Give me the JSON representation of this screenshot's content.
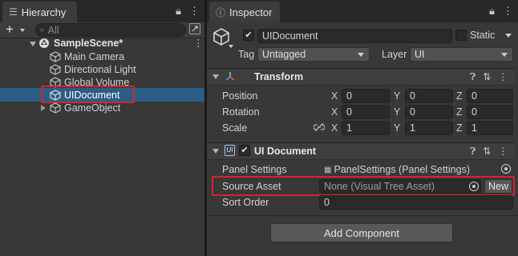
{
  "hierarchy": {
    "tab_label": "Hierarchy",
    "search_placeholder": "All",
    "add_label": "+",
    "scene": {
      "name": "SampleScene*"
    },
    "items": [
      {
        "label": "Main Camera"
      },
      {
        "label": "Directional Light"
      },
      {
        "label": "Global Volume"
      },
      {
        "label": "UIDocument"
      },
      {
        "label": "GameObject"
      }
    ]
  },
  "inspector": {
    "tab_label": "Inspector",
    "object_name": "UIDocument",
    "static_label": "Static",
    "tag_label": "Tag",
    "tag_value": "Untagged",
    "layer_label": "Layer",
    "layer_value": "UI",
    "transform": {
      "title": "Transform",
      "rows": [
        {
          "label": "Position",
          "x": "0",
          "y": "0",
          "z": "0"
        },
        {
          "label": "Rotation",
          "x": "0",
          "y": "0",
          "z": "0"
        },
        {
          "label": "Scale",
          "x": "1",
          "y": "1",
          "z": "1"
        }
      ],
      "axis_x": "X",
      "axis_y": "Y",
      "axis_z": "Z"
    },
    "ui_document": {
      "title": "UI Document",
      "icon_text": "UI",
      "panel_settings_label": "Panel Settings",
      "panel_settings_value": "PanelSettings (Panel Settings)",
      "source_asset_label": "Source Asset",
      "source_asset_value": "None (Visual Tree Asset)",
      "new_button": "New",
      "sort_order_label": "Sort Order",
      "sort_order_value": "0"
    },
    "add_component_label": "Add Component"
  },
  "colors": {
    "selection": "#2c5d87",
    "highlight": "#d9232b",
    "panel_bg": "#383838"
  }
}
